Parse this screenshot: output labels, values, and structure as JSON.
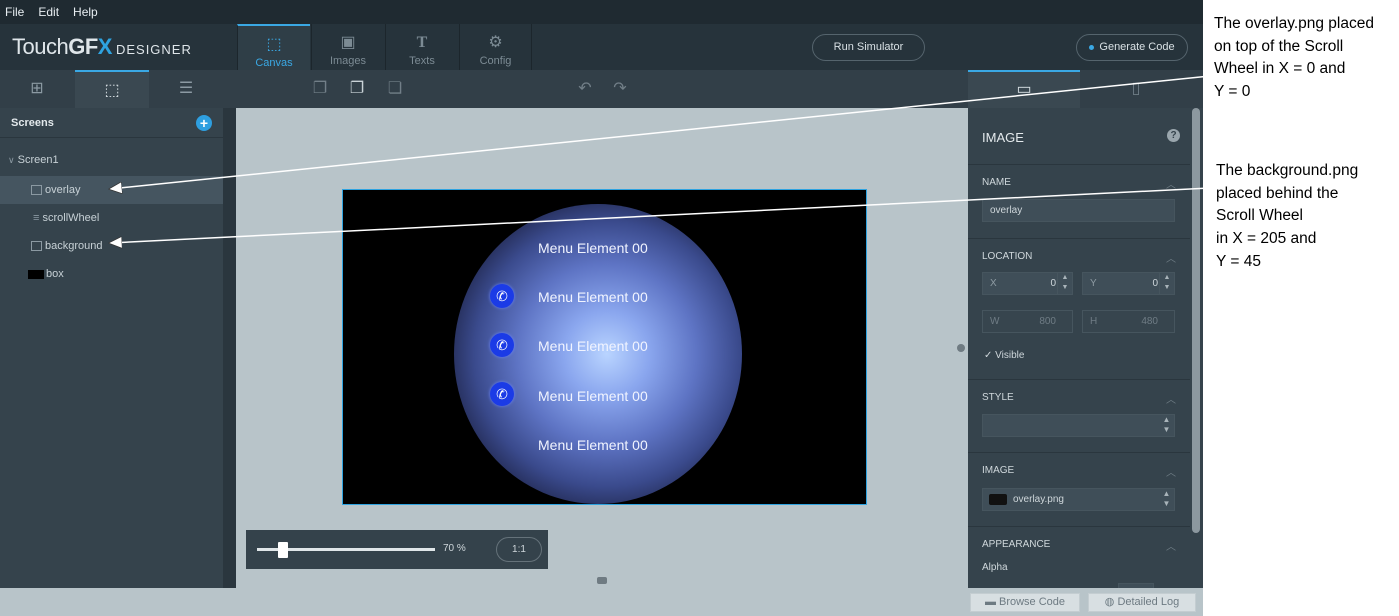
{
  "menubar": {
    "file": "File",
    "edit": "Edit",
    "help": "Help"
  },
  "header": {
    "logo": {
      "touch": "Touch",
      "gfx": "GF",
      "x": "X",
      "designer": "DESIGNER"
    },
    "tabs": [
      {
        "label": "Canvas",
        "icon": "canvas-icon"
      },
      {
        "label": "Images",
        "icon": "images-icon"
      },
      {
        "label": "Texts",
        "icon": "texts-icon"
      },
      {
        "label": "Config",
        "icon": "config-icon"
      }
    ],
    "run_simulator": "Run Simulator",
    "generate_code": "Generate Code"
  },
  "left_panel": {
    "title": "Screens",
    "tree": [
      {
        "label": "Screen1"
      },
      {
        "label": "overlay"
      },
      {
        "label": "scrollWheel"
      },
      {
        "label": "background"
      },
      {
        "label": "box"
      }
    ]
  },
  "canvas": {
    "menu_items": [
      "Menu Element 00",
      "Menu Element 00",
      "Menu Element 00",
      "Menu Element 00",
      "Menu Element 00"
    ],
    "zoom_value": "70 %",
    "zoom_fraction": 0.7,
    "one_to_one": "1:1"
  },
  "properties": {
    "section": "IMAGE",
    "name_title": "NAME",
    "name_value": "overlay",
    "location_title": "LOCATION",
    "x_label": "X",
    "x_value": "0",
    "y_label": "Y",
    "y_value": "0",
    "w_label": "W",
    "w_value": "800",
    "h_label": "H",
    "h_value": "480",
    "visible": "Visible",
    "style_title": "STYLE",
    "image_title": "IMAGE",
    "image_value": "overlay.png",
    "appearance_title": "APPEARANCE",
    "alpha_label": "Alpha"
  },
  "statusbar": {
    "browse_code": "Browse Code",
    "detailed_log": "Detailed Log"
  },
  "annotations": {
    "overlay_lines": [
      "The overlay.png placed",
      "on top of the Scroll",
      "Wheel in X = 0 and",
      "Y = 0"
    ],
    "background_lines": [
      "The background.png",
      "placed behind the",
      "Scroll Wheel",
      "in X = 205 and",
      "Y = 45"
    ]
  },
  "colors": {
    "accent": "#3aa8e4",
    "background": "#2c3a43"
  }
}
